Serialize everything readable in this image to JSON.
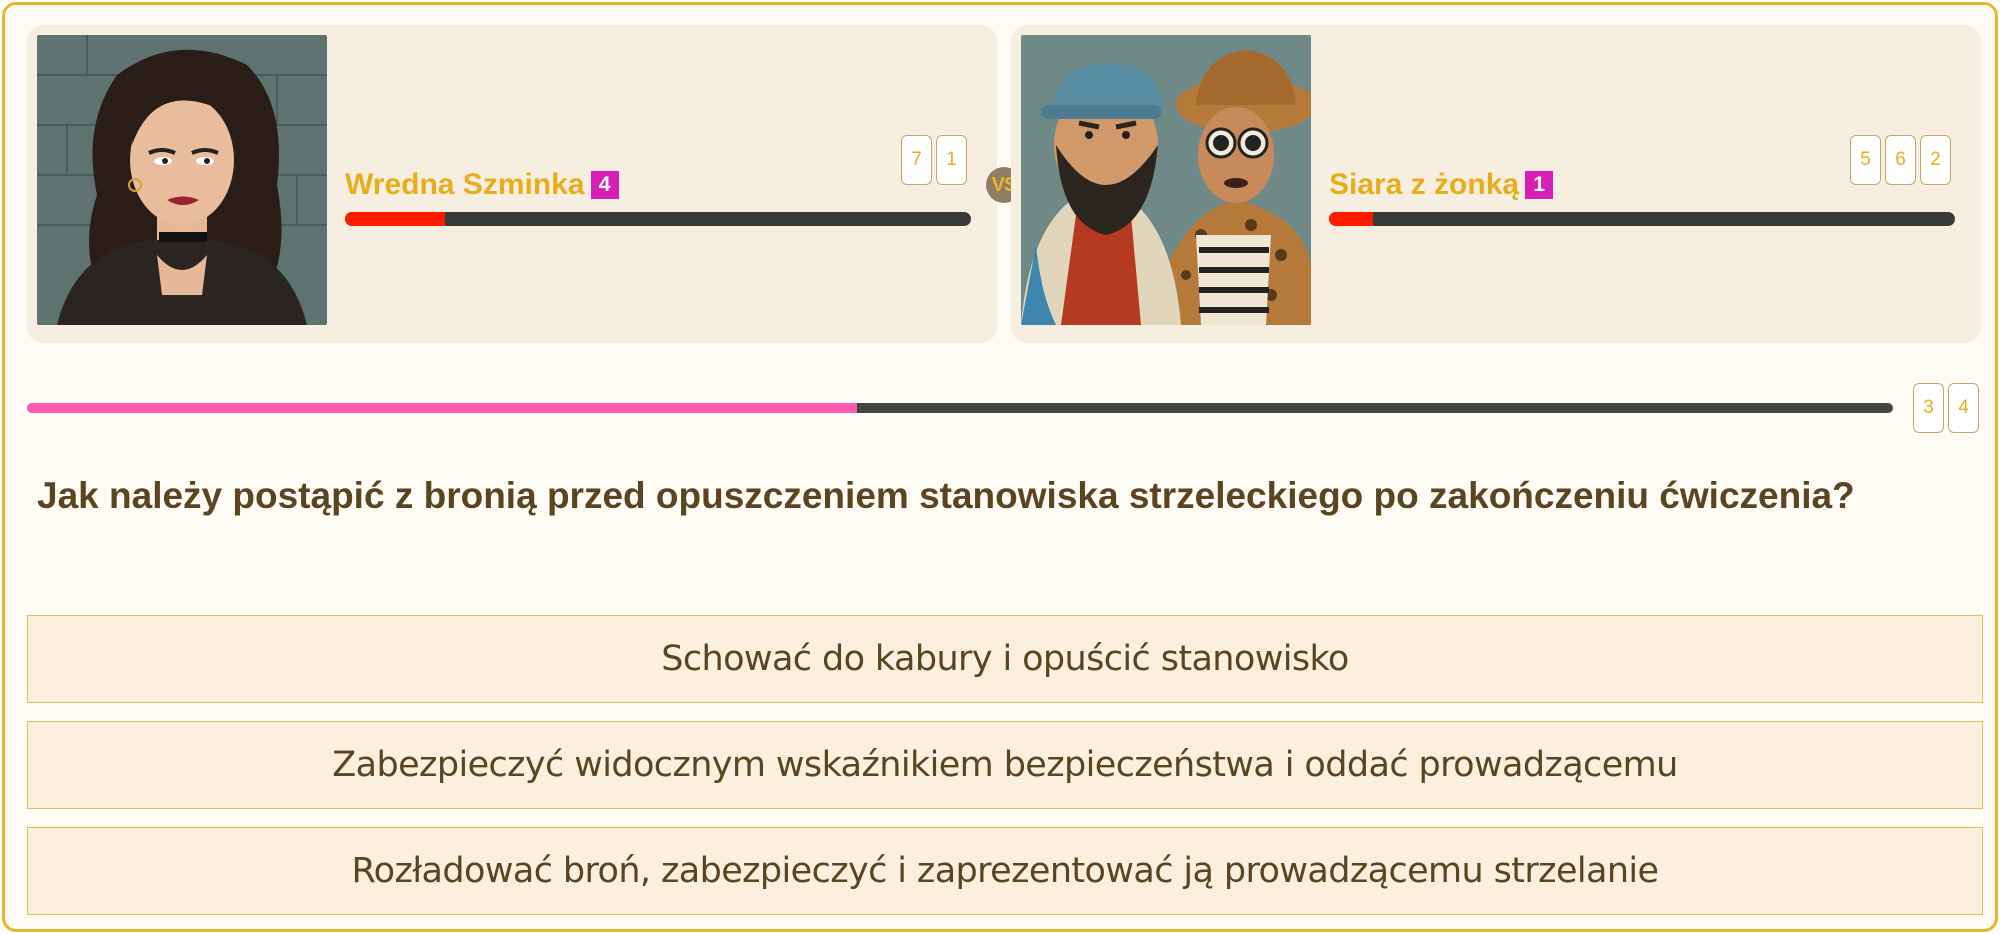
{
  "players": [
    {
      "name": "Wredna Szminka",
      "level": "4",
      "chips": [
        "7",
        "1"
      ],
      "hp_fraction": 0.16
    },
    {
      "name": "Siara z żonką",
      "level": "1",
      "chips": [
        "5",
        "6",
        "2"
      ],
      "hp_fraction": 0.07
    }
  ],
  "vs_label": "VS",
  "progress": {
    "fraction": 0.445,
    "chips": [
      "3",
      "4"
    ]
  },
  "question": "Jak należy postąpić z bronią przed opuszczeniem stanowiska strzeleckiego po zakończeniu ćwiczenia?",
  "answers": [
    "Schować do kabury i opuścić stanowisko",
    "Zabezpieczyć widocznym wskaźnikiem bezpieczeństwa i oddać prowadzącemu",
    "Rozładować broń, zabezpieczyć i zaprezentować ją prowadzącemu strzelanie"
  ],
  "colors": {
    "accent": "#e7ad1b",
    "level_badge": "#d61fb5",
    "hp_fill": "#ff1a00",
    "progress_fill": "#ff5ab3",
    "text_dark": "#5b4420"
  }
}
